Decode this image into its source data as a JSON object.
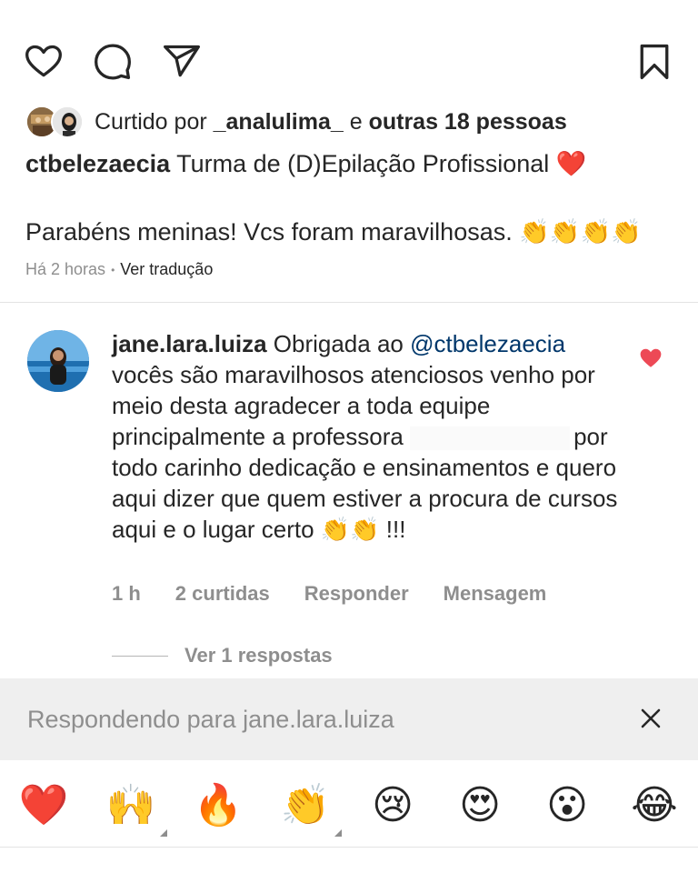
{
  "actions": {
    "like_icon": "heart-outline-icon",
    "comment_icon": "comment-bubble-icon",
    "share_icon": "paper-plane-icon",
    "save_icon": "bookmark-icon"
  },
  "likes": {
    "prefix": "Curtido por",
    "user": "_analulima_",
    "connector": "e",
    "others": "outras 18 pessoas"
  },
  "caption": {
    "user": "ctbelezaecia",
    "text": "Turma de (D)Epilação Profissional ❤️",
    "line2": "Parabéns meninas! Vcs foram maravilhosas. 👏👏👏👏"
  },
  "meta": {
    "time": "Há 2 horas",
    "separator": "•",
    "translate": "Ver tradução"
  },
  "comment": {
    "user": "jane.lara.luiza",
    "text_a": "Obrigada ao",
    "mention": "@ctbelezaecia",
    "text_b": "vocês são maravilhosos  atenciosos venho por meio desta agradecer  a toda equipe principalmente a professora",
    "text_c": "por todo carinho dedicação e ensinamentos  e quero aqui dizer que quem estiver a procura de cursos aqui e o lugar certo 👏👏 !!!",
    "time": "1 h",
    "likes": "2 curtidas",
    "reply": "Responder",
    "message": "Mensagem",
    "view_replies": "Ver 1 respostas",
    "heart_color": "#ed4956"
  },
  "reply_bar": {
    "text": "Respondendo para jane.lara.luiza"
  },
  "emoji_bar": [
    {
      "glyph": "❤️",
      "name": "red-heart-emoji"
    },
    {
      "glyph": "🙌",
      "name": "raised-hands-emoji"
    },
    {
      "glyph": "🔥",
      "name": "fire-emoji"
    },
    {
      "glyph": "👏",
      "name": "clapping-hands-emoji"
    },
    {
      "glyph": "😢",
      "name": "crying-face-emoji"
    },
    {
      "glyph": "😍",
      "name": "heart-eyes-emoji"
    },
    {
      "glyph": "😮",
      "name": "surprised-face-emoji"
    },
    {
      "glyph": "😂",
      "name": "tears-of-joy-emoji"
    }
  ]
}
